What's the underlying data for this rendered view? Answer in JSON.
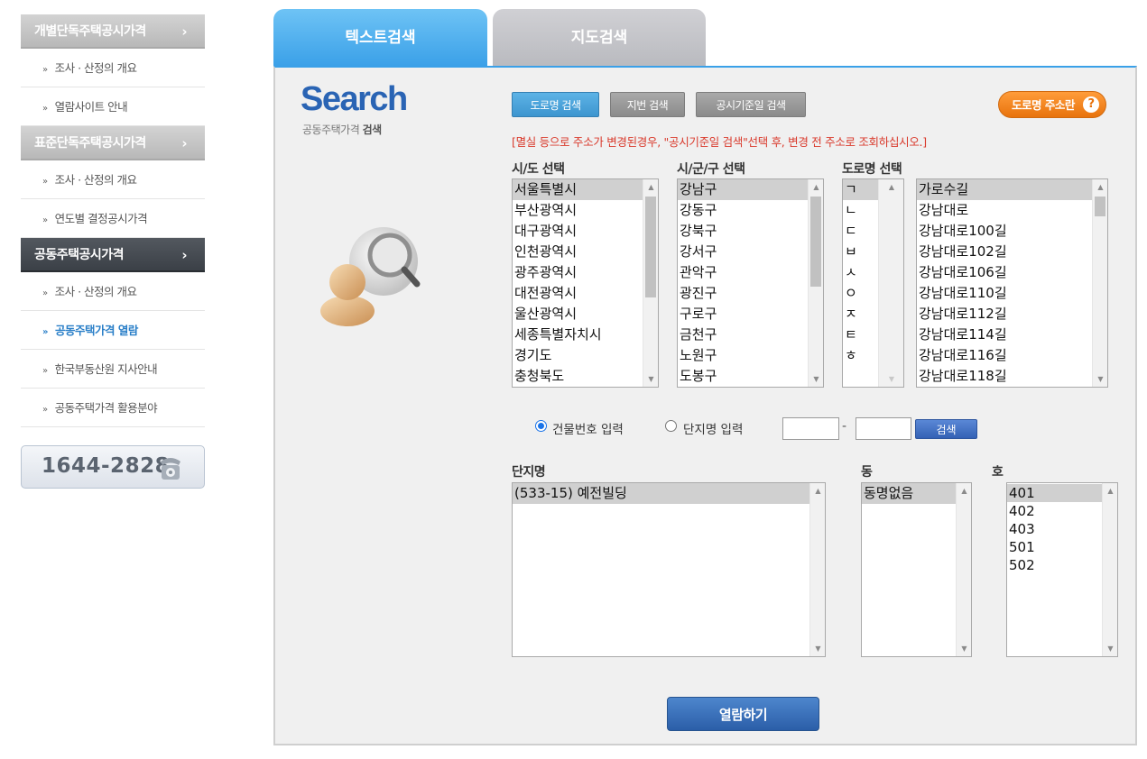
{
  "sidebar": {
    "sections": [
      {
        "title": "개별단독주택공시가격",
        "chevron": "›",
        "items": [
          "조사 · 산정의 개요",
          "열람사이트 안내"
        ]
      },
      {
        "title": "표준단독주택공시가격",
        "chevron": "›",
        "items": [
          "조사 · 산정의 개요",
          "연도별 결정공시가격"
        ]
      },
      {
        "title": "공동주택공시가격",
        "chevron": "›",
        "items": [
          "조사 · 산정의 개요",
          "공동주택가격 열람",
          "한국부동산원 지사안내",
          "공동주택가격 활용분야"
        ]
      }
    ],
    "bullet": "»",
    "phone": "1644-2828"
  },
  "tabs": {
    "text_search": "텍스트검색",
    "map_search": "지도검색"
  },
  "panel": {
    "logo": "Search",
    "sub_normal": "공동주택가격 ",
    "sub_bold": "검색",
    "buttons": {
      "road": "도로명 검색",
      "lot": "지번 검색",
      "date": "공시기준일 검색",
      "road_addr": "도로명 주소란",
      "help": "?"
    },
    "notice": "[멸실 등으로 주소가 변경된경우, \"공시기준일 검색\"선택 후, 변경 전 주소로 조회하십시오.]",
    "labels": {
      "sido": "시/도 선택",
      "sigungu": "시/군/구 선택",
      "road": "도로명 선택",
      "complex": "단지명",
      "dong": "동",
      "ho": "호"
    },
    "sido_list": [
      "서울특별시",
      "부산광역시",
      "대구광역시",
      "인천광역시",
      "광주광역시",
      "대전광역시",
      "울산광역시",
      "세종특별자치시",
      "경기도",
      "충청북도"
    ],
    "sigungu_list": [
      "강남구",
      "강동구",
      "강북구",
      "강서구",
      "관악구",
      "광진구",
      "구로구",
      "금천구",
      "노원구",
      "도봉구"
    ],
    "initial_list": [
      "ㄱ",
      "ㄴ",
      "ㄷ",
      "ㅂ",
      "ㅅ",
      "ㅇ",
      "ㅈ",
      "ㅌ",
      "ㅎ"
    ],
    "road_list": [
      "가로수길",
      "강남대로",
      "강남대로100길",
      "강남대로102길",
      "강남대로106길",
      "강남대로110길",
      "강남대로112길",
      "강남대로114길",
      "강남대로116길",
      "강남대로118길"
    ],
    "radio": {
      "building_no": "건물번호 입력",
      "complex_name": "단지명 입력"
    },
    "dash": "-",
    "search_button": "검색",
    "complex_list": [
      "(533-15) 예전빌딩"
    ],
    "dong_list": [
      "동명없음"
    ],
    "ho_list": [
      "401",
      "402",
      "403",
      "501",
      "502"
    ],
    "view_button": "열람하기"
  }
}
